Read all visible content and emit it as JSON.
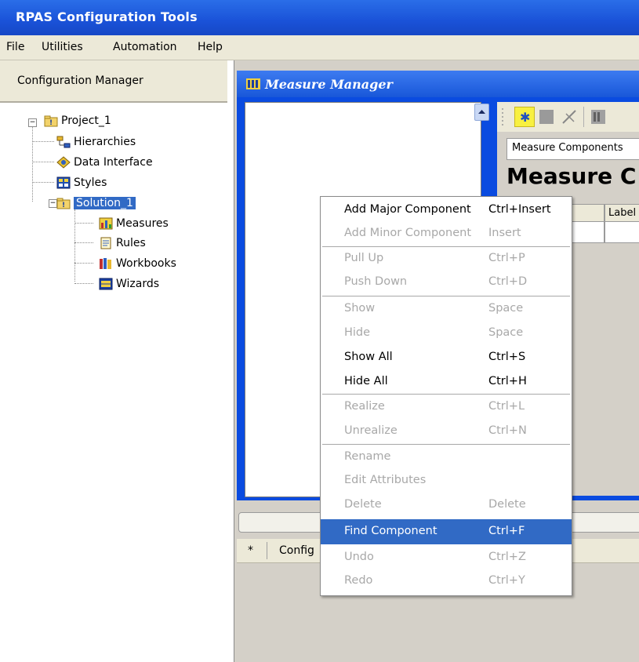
{
  "app": {
    "title": "RPAS Configuration Tools"
  },
  "menubar": {
    "items": [
      "File",
      "Utilities",
      "Automation",
      "Help"
    ]
  },
  "config_manager": {
    "title": "Configuration Manager",
    "tree": {
      "project": "Project_1",
      "project_children": [
        "Hierarchies",
        "Data Interface",
        "Styles"
      ],
      "solution": "Solution_1",
      "solution_children": [
        "Measures",
        "Rules",
        "Workbooks",
        "Wizards"
      ]
    }
  },
  "measure_manager": {
    "title": "Measure Manager",
    "tab_label": "Measure Components",
    "header": "Measure C",
    "column_label": "Label"
  },
  "bottom_pane": {
    "col_star": "*",
    "col_config": "Config"
  },
  "context_menu": {
    "items": [
      {
        "label": "Add Major Component",
        "shortcut": "Ctrl+Insert"
      },
      {
        "label": "Add Minor Component",
        "shortcut": "Insert"
      },
      {
        "label": "Pull Up",
        "shortcut": "Ctrl+P"
      },
      {
        "label": "Push Down",
        "shortcut": "Ctrl+D"
      },
      {
        "label": "Show",
        "shortcut": "Space"
      },
      {
        "label": "Hide",
        "shortcut": "Space"
      },
      {
        "label": "Show All",
        "shortcut": "Ctrl+S"
      },
      {
        "label": "Hide All",
        "shortcut": "Ctrl+H"
      },
      {
        "label": "Realize",
        "shortcut": "Ctrl+L"
      },
      {
        "label": "Unrealize",
        "shortcut": "Ctrl+N"
      },
      {
        "label": "Rename",
        "shortcut": ""
      },
      {
        "label": "Edit Attributes",
        "shortcut": ""
      },
      {
        "label": "Delete",
        "shortcut": "Delete"
      },
      {
        "label": "Find Component",
        "shortcut": "Ctrl+F"
      },
      {
        "label": "Undo",
        "shortcut": "Ctrl+Z"
      },
      {
        "label": "Redo",
        "shortcut": "Ctrl+Y"
      }
    ]
  },
  "colors": {
    "title_blue": "#1a52d8",
    "selection_blue": "#316ac5",
    "disabled_text": "#a8a8a8"
  },
  "icons": {
    "project": "folder-project-icon",
    "hierarchies": "hierarchy-icon",
    "data_interface": "data-interface-icon",
    "styles": "styles-icon",
    "solution": "folder-solution-icon",
    "measures": "measures-icon",
    "rules": "rules-icon",
    "workbooks": "workbooks-icon",
    "wizards": "wizards-icon"
  }
}
